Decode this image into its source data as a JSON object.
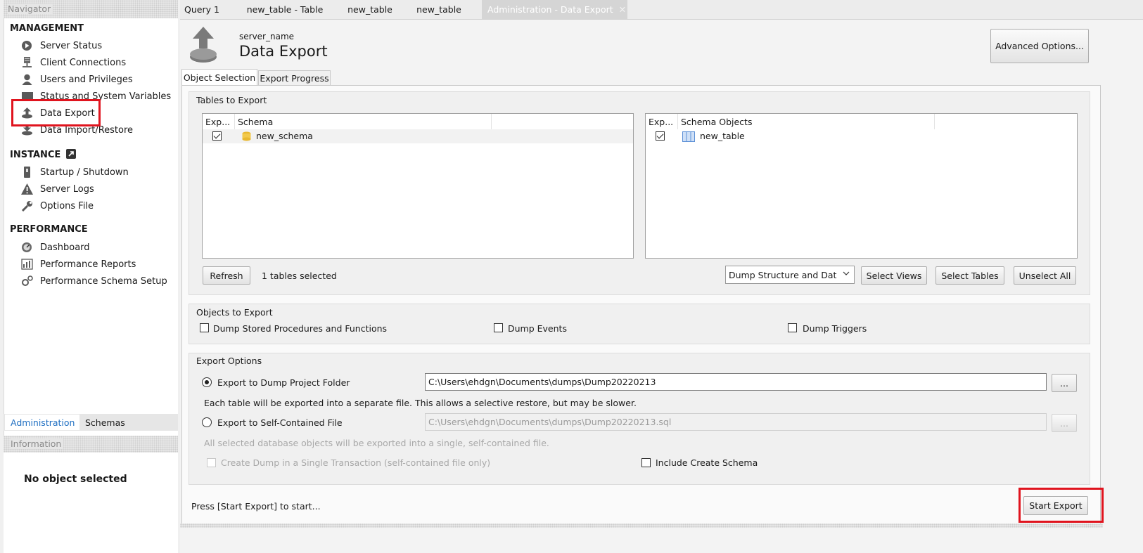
{
  "navigator": {
    "title": "Navigator",
    "management": {
      "title": "MANAGEMENT",
      "items": [
        {
          "label": "Server Status",
          "icon": "play-circle-icon"
        },
        {
          "label": "Client Connections",
          "icon": "server-plug-icon"
        },
        {
          "label": "Users and Privileges",
          "icon": "user-icon"
        },
        {
          "label": "Status and System Variables",
          "icon": "monitor-icon"
        },
        {
          "label": "Data Export",
          "icon": "upload-icon"
        },
        {
          "label": "Data Import/Restore",
          "icon": "download-icon"
        }
      ]
    },
    "instance": {
      "title": "INSTANCE",
      "items": [
        {
          "label": "Startup / Shutdown",
          "icon": "power-icon"
        },
        {
          "label": "Server Logs",
          "icon": "warning-icon"
        },
        {
          "label": "Options File",
          "icon": "wrench-icon"
        }
      ]
    },
    "performance": {
      "title": "PERFORMANCE",
      "items": [
        {
          "label": "Dashboard",
          "icon": "dashboard-icon"
        },
        {
          "label": "Performance Reports",
          "icon": "reports-icon"
        },
        {
          "label": "Performance Schema Setup",
          "icon": "settings-icon"
        }
      ]
    },
    "tabs": {
      "administration": "Administration",
      "schemas": "Schemas"
    }
  },
  "information": {
    "title": "Information",
    "empty_text": "No object selected"
  },
  "top_tabs": [
    "Query 1",
    "new_table - Table",
    "new_table",
    "new_table",
    "Administration - Data Export"
  ],
  "header": {
    "server_name": "server_name",
    "title": "Data Export",
    "advanced_button": "Advanced Options..."
  },
  "subtabs": {
    "object_selection": "Object Selection",
    "export_progress": "Export Progress"
  },
  "tables_to_export": {
    "legend": "Tables to Export",
    "schema_list": {
      "col_export": "Exp...",
      "col_schema": "Schema",
      "rows": [
        {
          "checked": true,
          "name": "new_schema"
        }
      ]
    },
    "objects_list": {
      "col_export": "Exp...",
      "col_objects": "Schema Objects",
      "rows": [
        {
          "checked": true,
          "name": "new_table"
        }
      ]
    },
    "refresh_button": "Refresh",
    "selected_count": "1 tables selected",
    "dump_mode": "Dump Structure and Dat",
    "select_views": "Select Views",
    "select_tables": "Select Tables",
    "unselect_all": "Unselect All"
  },
  "objects_to_export": {
    "legend": "Objects to Export",
    "procedures": "Dump Stored Procedures and Functions",
    "events": "Dump Events",
    "triggers": "Dump Triggers"
  },
  "export_options": {
    "legend": "Export Options",
    "folder_label": "Export to Dump Project Folder",
    "folder_path": "C:\\Users\\ehdgn\\Documents\\dumps\\Dump20220213",
    "folder_note": "Each table will be exported into a separate file. This allows a selective restore, but may be slower.",
    "file_label": "Export to Self-Contained File",
    "file_path": "C:\\Users\\ehdgn\\Documents\\dumps\\Dump20220213.sql",
    "file_note": "All selected database objects will be exported into a single, self-contained file.",
    "single_transaction": "Create Dump in a Single Transaction (self-contained file only)",
    "include_schema": "Include Create Schema",
    "browse": "..."
  },
  "footer": {
    "status": "Press [Start Export] to start...",
    "start_button": "Start Export"
  }
}
